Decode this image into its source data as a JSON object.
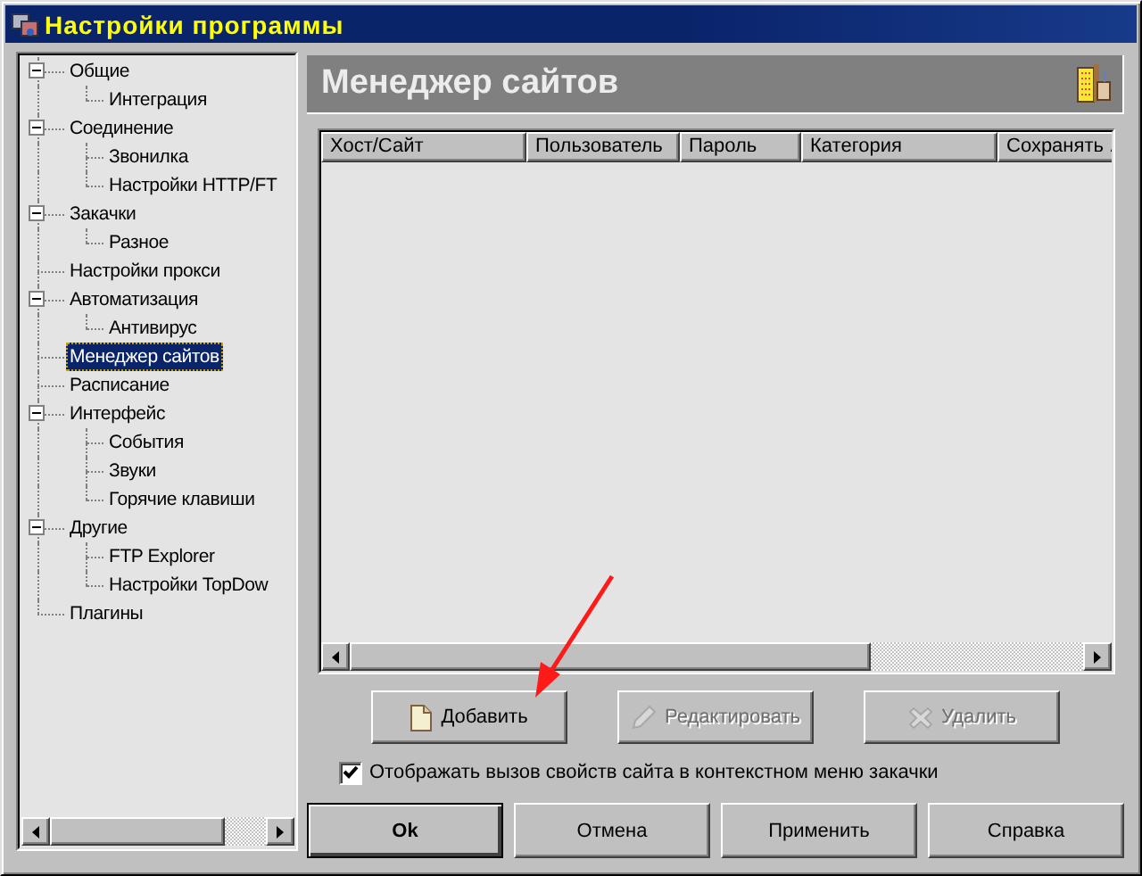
{
  "window": {
    "title": "Настройки программы"
  },
  "tree": {
    "items": [
      {
        "label": "Общие",
        "expanded": true,
        "selected": false,
        "children": [
          {
            "label": "Интеграция",
            "selected": false
          }
        ]
      },
      {
        "label": "Соединение",
        "expanded": true,
        "selected": false,
        "children": [
          {
            "label": "Звонилка",
            "selected": false
          },
          {
            "label": "Настройки HTTP/FT",
            "selected": false
          }
        ]
      },
      {
        "label": "Закачки",
        "expanded": true,
        "selected": false,
        "children": [
          {
            "label": "Разное",
            "selected": false
          }
        ]
      },
      {
        "label": "Настройки прокси",
        "selected": false
      },
      {
        "label": "Автоматизация",
        "expanded": true,
        "selected": false,
        "children": [
          {
            "label": "Антивирус",
            "selected": false
          }
        ]
      },
      {
        "label": "Менеджер сайтов",
        "selected": true
      },
      {
        "label": "Расписание",
        "selected": false
      },
      {
        "label": "Интерфейс",
        "expanded": true,
        "selected": false,
        "children": [
          {
            "label": "События",
            "selected": false
          },
          {
            "label": "Звуки",
            "selected": false
          },
          {
            "label": "Горячие клавиши",
            "selected": false
          }
        ]
      },
      {
        "label": "Другие",
        "expanded": true,
        "selected": false,
        "children": [
          {
            "label": "FTP Explorer",
            "selected": false
          },
          {
            "label": "Настройки TopDow",
            "selected": false
          }
        ]
      },
      {
        "label": "Плагины",
        "selected": false
      }
    ]
  },
  "page": {
    "title": "Менеджер сайтов"
  },
  "table": {
    "columns": [
      "Хост/Сайт",
      "Пользователь",
      "Пароль",
      "Категория",
      "Сохранять ."
    ]
  },
  "actions": [
    {
      "label": "Добавить",
      "kind": "add",
      "disabled": false
    },
    {
      "label": "Редактировать",
      "kind": "edit",
      "disabled": true
    },
    {
      "label": "Удалить",
      "kind": "delete",
      "disabled": true
    }
  ],
  "option": {
    "label": "Отображать вызов свойств сайта в контекстном меню закачки",
    "checked": true
  },
  "buttons": [
    {
      "label": "Ok",
      "default": true
    },
    {
      "label": "Отмена",
      "default": false
    },
    {
      "label": "Применить",
      "default": false
    },
    {
      "label": "Справка",
      "default": false
    }
  ]
}
